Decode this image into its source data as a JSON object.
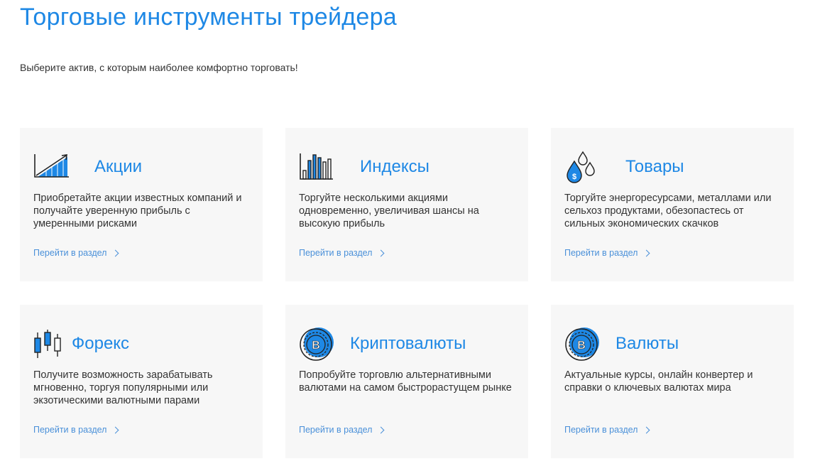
{
  "header": {
    "title": "Торговые инструменты трейдера",
    "subtitle": "Выберите актив, с которым наиболее комфортно торговать!"
  },
  "colors": {
    "accent": "#1e88e5",
    "card_background": "#f7f7f7",
    "text": "#333333"
  },
  "cards": [
    {
      "icon": "rising-chart-icon",
      "title": "Акции",
      "description": "Приобретайте акции известных компаний и получайте уверенную прибыль с умеренными рисками",
      "link": "Перейти в раздел"
    },
    {
      "icon": "bar-chart-icon",
      "title": "Индексы",
      "description": "Торгуйте несколькими акциями одновременно, увеличивая шансы на высокую прибыль",
      "link": "Перейти в раздел"
    },
    {
      "icon": "oil-drops-icon",
      "title": "Товары",
      "description": "Торгуйте энергоресурсами, металлами или сельхоз продуктами, обезопастесь от сильных экономических скачков",
      "link": "Перейти в раздел"
    },
    {
      "icon": "candlestick-icon",
      "title": "Форекс",
      "description": "Получите возможность зарабатывать мгновенно, торгуя популярными или экзотическими валютными парами",
      "link": "Перейти в раздел"
    },
    {
      "icon": "bitcoin-coin-icon",
      "title": "Криптовалюты",
      "description": "Попробуйте торговлю альтернативными валютами на самом быстрорастущем рынке",
      "link": "Перейти в раздел"
    },
    {
      "icon": "bitcoin-coin-icon",
      "title": "Валюты",
      "description": "Актуальные курсы, онлайн конвертер и справки о ключевых валютах мира",
      "link": "Перейти в раздел"
    }
  ]
}
